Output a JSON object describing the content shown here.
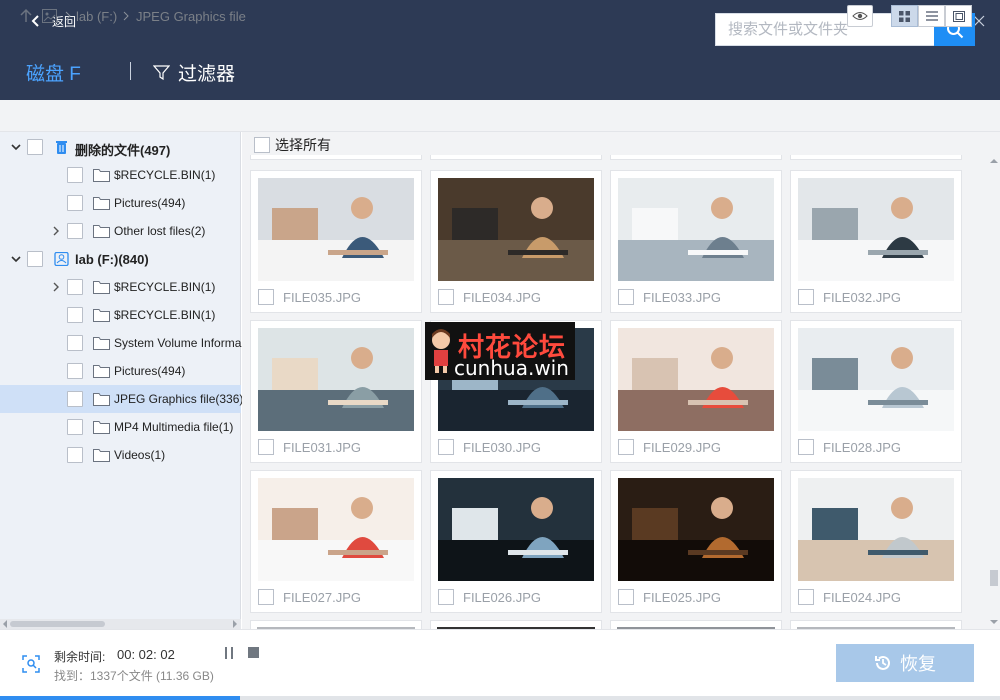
{
  "titlebar": {
    "back_label": "返回"
  },
  "header": {
    "disk_label": "磁盘 F",
    "filter_label": "过滤器",
    "search_placeholder": "搜索文件或文件夹"
  },
  "breadcrumb": {
    "items": [
      "lab (F:)",
      "JPEG Graphics file"
    ]
  },
  "sidebar": {
    "items": [
      {
        "label": "删除的文件(497)",
        "level": 0,
        "expanded": true,
        "icon": "trash-icon"
      },
      {
        "label": "$RECYCLE.BIN(1)",
        "level": 1,
        "icon": "folder-icon"
      },
      {
        "label": "Pictures(494)",
        "level": 1,
        "icon": "folder-icon"
      },
      {
        "label": "Other lost files(2)",
        "level": 1,
        "collapsed": true,
        "icon": "folder-icon"
      },
      {
        "label": "lab (F:)(840)",
        "level": 0,
        "expanded": true,
        "icon": "drive-icon"
      },
      {
        "label": "$RECYCLE.BIN(1)",
        "level": 1,
        "collapsed": true,
        "icon": "folder-icon"
      },
      {
        "label": "$RECYCLE.BIN(1)",
        "level": 1,
        "icon": "folder-icon"
      },
      {
        "label": "System Volume Informa",
        "level": 1,
        "icon": "folder-icon"
      },
      {
        "label": "Pictures(494)",
        "level": 1,
        "icon": "folder-icon"
      },
      {
        "label": "JPEG Graphics file(336)",
        "level": 1,
        "selected": true,
        "icon": "folder-icon"
      },
      {
        "label": "MP4 Multimedia file(1)",
        "level": 1,
        "icon": "folder-icon"
      },
      {
        "label": "Videos(1)",
        "level": 1,
        "icon": "folder-icon"
      }
    ]
  },
  "content": {
    "select_all_label": "选择所有",
    "files": [
      "FILE035.JPG",
      "FILE034.JPG",
      "FILE033.JPG",
      "FILE032.JPG",
      "FILE031.JPG",
      "FILE030.JPG",
      "FILE029.JPG",
      "FILE028.JPG",
      "FILE027.JPG",
      "FILE026.JPG",
      "FILE025.JPG",
      "FILE024.JPG"
    ]
  },
  "footer": {
    "remaining_label": "剩余时间:",
    "remaining_value": "00: 02: 02",
    "found_text": "找到：1337个文件 (11.36 GB)",
    "recover_label": "恢复",
    "progress": 0.24
  },
  "watermark": {
    "top": "村花论坛",
    "bottom": "cunhua.win"
  },
  "colors": {
    "header_bg": "#2d3a55",
    "accent": "#1e8ef5",
    "disk_label": "#4ba3ff",
    "recover_button": "#a8c8e9"
  }
}
